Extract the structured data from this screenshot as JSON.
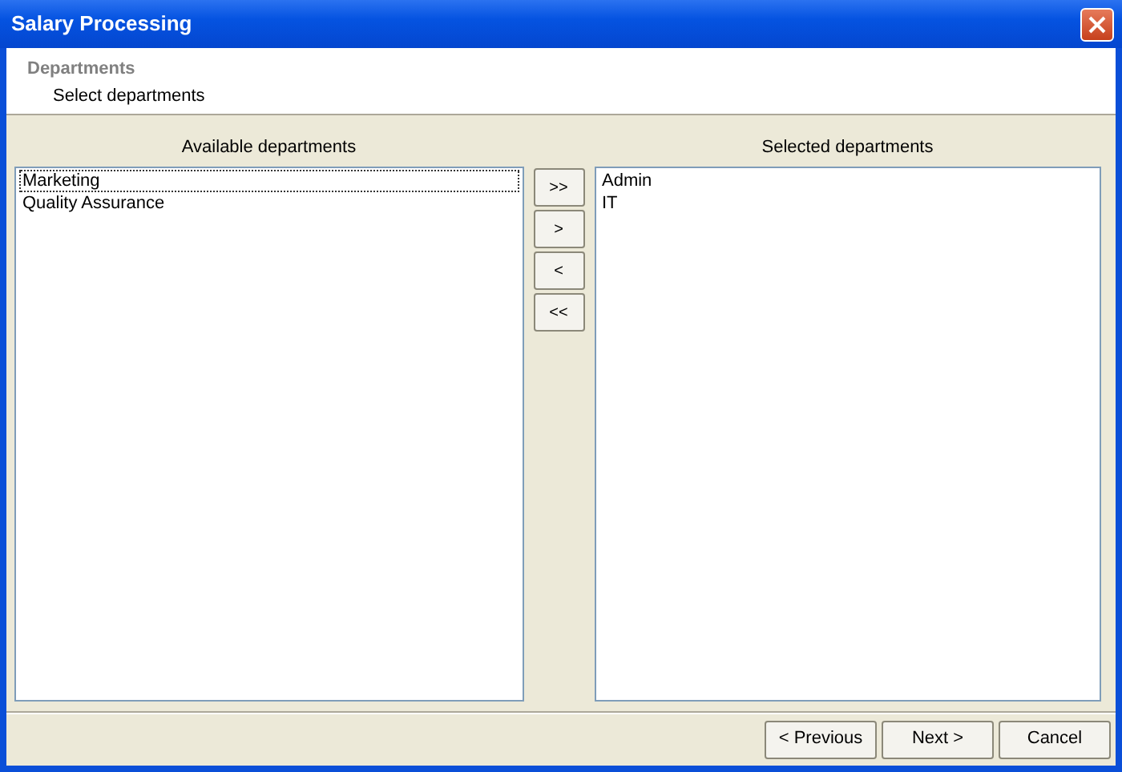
{
  "window": {
    "title": "Salary Processing"
  },
  "header": {
    "title": "Departments",
    "subtitle": "Select departments"
  },
  "available": {
    "label": "Available departments",
    "items": [
      {
        "text": "Marketing",
        "focused": true
      },
      {
        "text": "Quality Assurance",
        "focused": false
      }
    ]
  },
  "move_buttons": [
    ">>",
    ">",
    "<",
    "<<"
  ],
  "selected": {
    "label": "Selected departments",
    "items": [
      {
        "text": "Admin",
        "focused": false
      },
      {
        "text": "IT",
        "focused": false
      }
    ]
  },
  "buttons": [
    "< Previous",
    "Next >",
    "Cancel"
  ]
}
